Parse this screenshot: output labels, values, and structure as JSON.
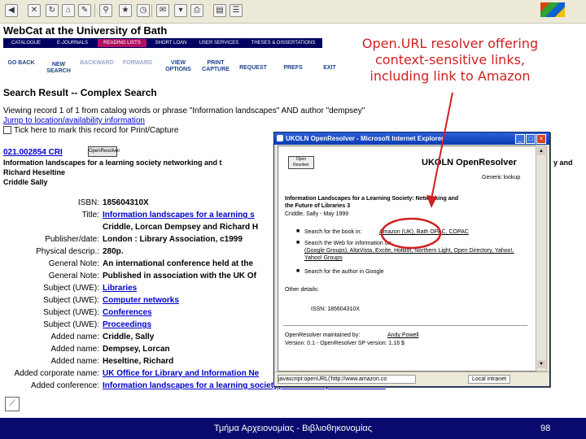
{
  "browser": {
    "toolbar_icons": [
      "back-icon",
      "forward-icon",
      "stop-icon",
      "refresh-icon",
      "home-icon",
      "search-icon",
      "favorites-icon",
      "history-icon",
      "mail-icon",
      "print-icon",
      "edit-icon"
    ],
    "logo": "windows-logo"
  },
  "webcat": {
    "title": "WebCat at the University of Bath",
    "nav": [
      {
        "label": "CATALOGUE",
        "active": false
      },
      {
        "label": "E-JOURNALS",
        "active": false
      },
      {
        "label": "READING LISTS",
        "active": true
      },
      {
        "label": "SHORT LOAN",
        "active": false
      },
      {
        "label": "USER SERVICES",
        "active": false
      },
      {
        "label": "THESES & DISSERTATIONS",
        "active": false
      }
    ],
    "tools": [
      {
        "label": "GO BACK",
        "dim": false
      },
      {
        "label": "NEW SEARCH",
        "dim": false
      },
      {
        "label": "BACKWARD",
        "dim": true
      },
      {
        "label": "FORWARD",
        "dim": true
      },
      {
        "label": "VIEW OPTIONS",
        "dim": false
      },
      {
        "label": "PRINT CAPTURE",
        "dim": false
      },
      {
        "label": "REQUEST",
        "dim": false
      },
      {
        "label": "PREFS",
        "dim": false
      },
      {
        "label": "EXIT",
        "dim": false
      }
    ],
    "search_heading": "Search Result -- Complex Search",
    "viewing_text": "Viewing record 1 of 1 from catalog words or phrase \"Information landscapes\" AND author \"dempsey\"",
    "jump_link": "Jump to location/availability information",
    "tick_text": "Tick here to mark this record for Print/Capture",
    "record_id": "021.002854 CRI",
    "button_label": "OpenResolver",
    "record_title_line1": "Information landscapes for a learning society networking and t",
    "record_title_line1_right": "y and",
    "record_title_line2": "Richard Heseltine",
    "record_title_line3": "Criddle Sally",
    "fields": [
      {
        "label": "ISBN:",
        "value": "185604310X",
        "link": false
      },
      {
        "label": "Title:",
        "value": "Information landscapes for a learning s",
        "link": true
      },
      {
        "label": "",
        "value": "Criddle, Lorcan Dempsey and Richard H",
        "link": false
      },
      {
        "label": "Publisher/date:",
        "value": "London : Library Association, c1999",
        "link": false
      },
      {
        "label": "Physical descrip.:",
        "value": "280p.",
        "link": false
      },
      {
        "label": "General Note:",
        "value": "An international conference held at the",
        "link": false
      },
      {
        "label": "General Note:",
        "value": "Published in association with the UK Of",
        "link": false
      },
      {
        "label": "Subject (UWE):",
        "value": "Libraries",
        "link": true
      },
      {
        "label": "Subject (UWE):",
        "value": "Computer networks",
        "link": true
      },
      {
        "label": "Subject (UWE):",
        "value": "Conferences",
        "link": true
      },
      {
        "label": "Subject (UWE):",
        "value": "Proceedings",
        "link": true
      },
      {
        "label": "Added name:",
        "value": "Criddle, Sally",
        "link": false
      },
      {
        "label": "Added name:",
        "value": "Dempsey, Lorcan",
        "link": false
      },
      {
        "label": "Added name:",
        "value": "Heseltine, Richard",
        "link": false
      },
      {
        "label": "Added corporate name:",
        "value": "UK Office for Library and Information Ne",
        "link": true
      },
      {
        "label": "Added conference:",
        "value": "Information landscapes for a learning society(Conference) 3 : 1998 : Bath",
        "link": true
      }
    ]
  },
  "callout": {
    "line1": "Open.URL resolver offering",
    "line2": "context-sensitive links,",
    "line3": "including link to Amazon"
  },
  "popup": {
    "title": "UKOLN OpenResolver - Microsoft Internet Explorer",
    "logo_text": "UKOLN OpenResolver",
    "button_label": "Open Resolver",
    "search_link": "Generic lookup",
    "book_title_1": "Information Landscapes for a Learning Society: Networking and",
    "book_title_2": "the Future of Libraries 3",
    "book_meta": "Criddle, Sally - May 1999",
    "bullet1_prefix": "Search for the book in:",
    "bullet1_links": "Amazon (UK), Bath OPAC, COPAC",
    "bullet2_prefix": "Search the Web for information on:",
    "bullet2_links": "(Google Groups), AltaVista, Excite, HotBot, Northern Light, Open Directory, Yahoo!, Yahoo! Groups",
    "bullet3_prefix": "Search for the author in Google",
    "other_details": "Other details:",
    "isbn": "ISSN: 185604310X",
    "maintained_by": "OpenResolver maintained by:",
    "maintainer": "Andy Powell",
    "version": "Version: 0.1 - OpenResolver SP version: 1.16 $",
    "status_url": "javascript:openURL('http://www.amazon.co",
    "status_zone": "Local intranet"
  },
  "footer": {
    "text": "Τμήμα Αρχειονομίας - Βιβλιοθηκονομίας",
    "page": "98"
  },
  "colors": {
    "nav_bg": "#000060",
    "nav_active": "#b01060",
    "footer_bg": "#0a0a6e",
    "callout": "#d02020",
    "link": "#0000cc"
  }
}
